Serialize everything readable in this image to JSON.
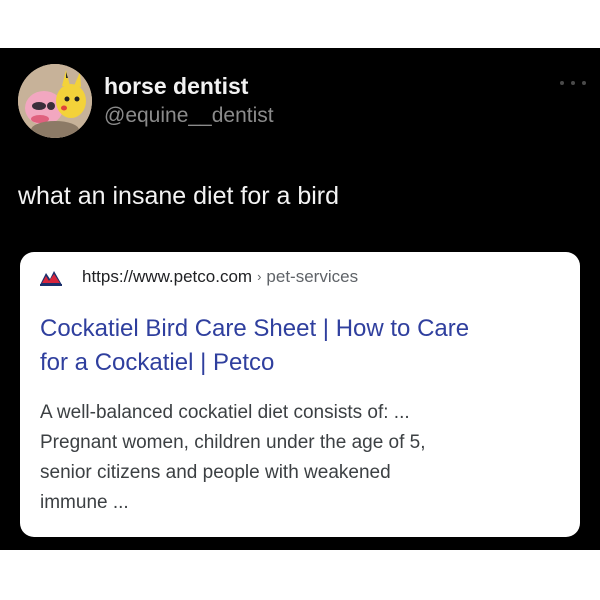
{
  "tweet": {
    "display_name": "horse dentist",
    "handle": "@equine__dentist",
    "text": "what an insane diet for a bird",
    "more_icon": "more-horizontal-icon"
  },
  "search_result": {
    "url": "https://www.petco.com",
    "separator": "›",
    "path": "pet-services",
    "title": "Cockatiel Bird Care Sheet | How to Care\nfor a Cockatiel | Petco",
    "snippet": "A well-balanced cockatiel diet consists of: ...\nPregnant women, children under the age of 5,\nsenior citizens and people with weakened\nimmune ...",
    "favicon": "petco-logo-icon"
  },
  "colors": {
    "background": "#000000",
    "card": "#ffffff",
    "title_link": "#2f3f9e",
    "handle": "#8b8b8b"
  }
}
